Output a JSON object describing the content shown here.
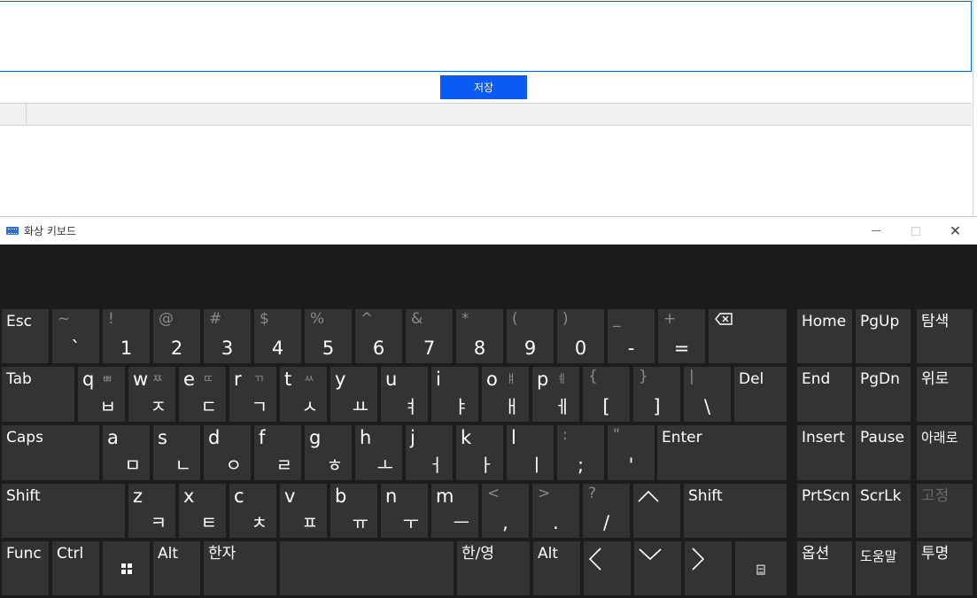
{
  "app": {
    "save_label": "저장"
  },
  "osk": {
    "title": "화상 키보드",
    "icons": {
      "app": "keyboard-icon",
      "minimize": "minimize-icon",
      "maximize": "maximize-icon",
      "close": "close-icon"
    },
    "row1": {
      "esc": "Esc",
      "num": [
        {
          "top": "~",
          "bot": "`"
        },
        {
          "top": "!",
          "bot": "1"
        },
        {
          "top": "@",
          "bot": "2"
        },
        {
          "top": "#",
          "bot": "3"
        },
        {
          "top": "$",
          "bot": "4"
        },
        {
          "top": "%",
          "bot": "5"
        },
        {
          "top": "^",
          "bot": "6"
        },
        {
          "top": "&",
          "bot": "7"
        },
        {
          "top": "*",
          "bot": "8"
        },
        {
          "top": "(",
          "bot": "9"
        },
        {
          "top": ")",
          "bot": "0"
        },
        {
          "top": "_",
          "bot": "-"
        },
        {
          "top": "+",
          "bot": "="
        }
      ],
      "backspace_icon": "backspace-icon",
      "home": "Home",
      "pgup": "PgUp",
      "search": "탐색"
    },
    "row2": {
      "tab": "Tab",
      "letters": [
        {
          "en": "q",
          "shift": "ㅃ",
          "ko": "ㅂ"
        },
        {
          "en": "w",
          "shift": "ㅉ",
          "ko": "ㅈ"
        },
        {
          "en": "e",
          "shift": "ㄸ",
          "ko": "ㄷ"
        },
        {
          "en": "r",
          "shift": "ㄲ",
          "ko": "ㄱ"
        },
        {
          "en": "t",
          "shift": "ㅆ",
          "ko": "ㅅ"
        },
        {
          "en": "y",
          "shift": "",
          "ko": "ㅛ"
        },
        {
          "en": "u",
          "shift": "",
          "ko": "ㅕ"
        },
        {
          "en": "i",
          "shift": "",
          "ko": "ㅑ"
        },
        {
          "en": "o",
          "shift": "ㅒ",
          "ko": "ㅐ"
        },
        {
          "en": "p",
          "shift": "ㅖ",
          "ko": "ㅔ"
        }
      ],
      "brackets": [
        {
          "top": "{",
          "bot": "["
        },
        {
          "top": "}",
          "bot": "]"
        },
        {
          "top": "|",
          "bot": "\\"
        }
      ],
      "del": "Del",
      "end": "End",
      "pgdn": "PgDn",
      "up": "위로"
    },
    "row3": {
      "caps": "Caps",
      "letters": [
        {
          "en": "a",
          "ko": "ㅁ"
        },
        {
          "en": "s",
          "ko": "ㄴ"
        },
        {
          "en": "d",
          "ko": "ㅇ"
        },
        {
          "en": "f",
          "ko": "ㄹ"
        },
        {
          "en": "g",
          "ko": "ㅎ"
        },
        {
          "en": "h",
          "ko": "ㅗ"
        },
        {
          "en": "j",
          "ko": "ㅓ"
        },
        {
          "en": "k",
          "ko": "ㅏ"
        },
        {
          "en": "l",
          "ko": "ㅣ"
        }
      ],
      "punct": [
        {
          "top": ":",
          "bot": ";"
        },
        {
          "top": "\"",
          "bot": "'"
        }
      ],
      "enter": "Enter",
      "insert": "Insert",
      "pause": "Pause",
      "down": "아래로"
    },
    "row4": {
      "shift": "Shift",
      "letters": [
        {
          "en": "z",
          "ko": "ㅋ"
        },
        {
          "en": "x",
          "ko": "ㅌ"
        },
        {
          "en": "c",
          "ko": "ㅊ"
        },
        {
          "en": "v",
          "ko": "ㅍ"
        },
        {
          "en": "b",
          "ko": "ㅠ"
        },
        {
          "en": "n",
          "ko": "ㅜ"
        },
        {
          "en": "m",
          "ko": "ㅡ"
        }
      ],
      "punct": [
        {
          "top": "<",
          "bot": ","
        },
        {
          "top": ">",
          "bot": "."
        },
        {
          "top": "?",
          "bot": "/"
        }
      ],
      "up_arrow": "^",
      "shift_right": "Shift",
      "prtscn": "PrtScn",
      "scrlk": "ScrLk",
      "dock": "고정"
    },
    "row5": {
      "func": "Func",
      "ctrl": "Ctrl",
      "win_icon": "windows-icon",
      "alt": "Alt",
      "hanja": "한자",
      "hanyeong": "한/영",
      "alt_right": "Alt",
      "left_arrow": "<",
      "down_arrow": "v",
      "right_arrow": ">",
      "menu_icon": "context-menu-icon",
      "options": "옵션",
      "help": "도움말",
      "fade": "투명"
    }
  }
}
